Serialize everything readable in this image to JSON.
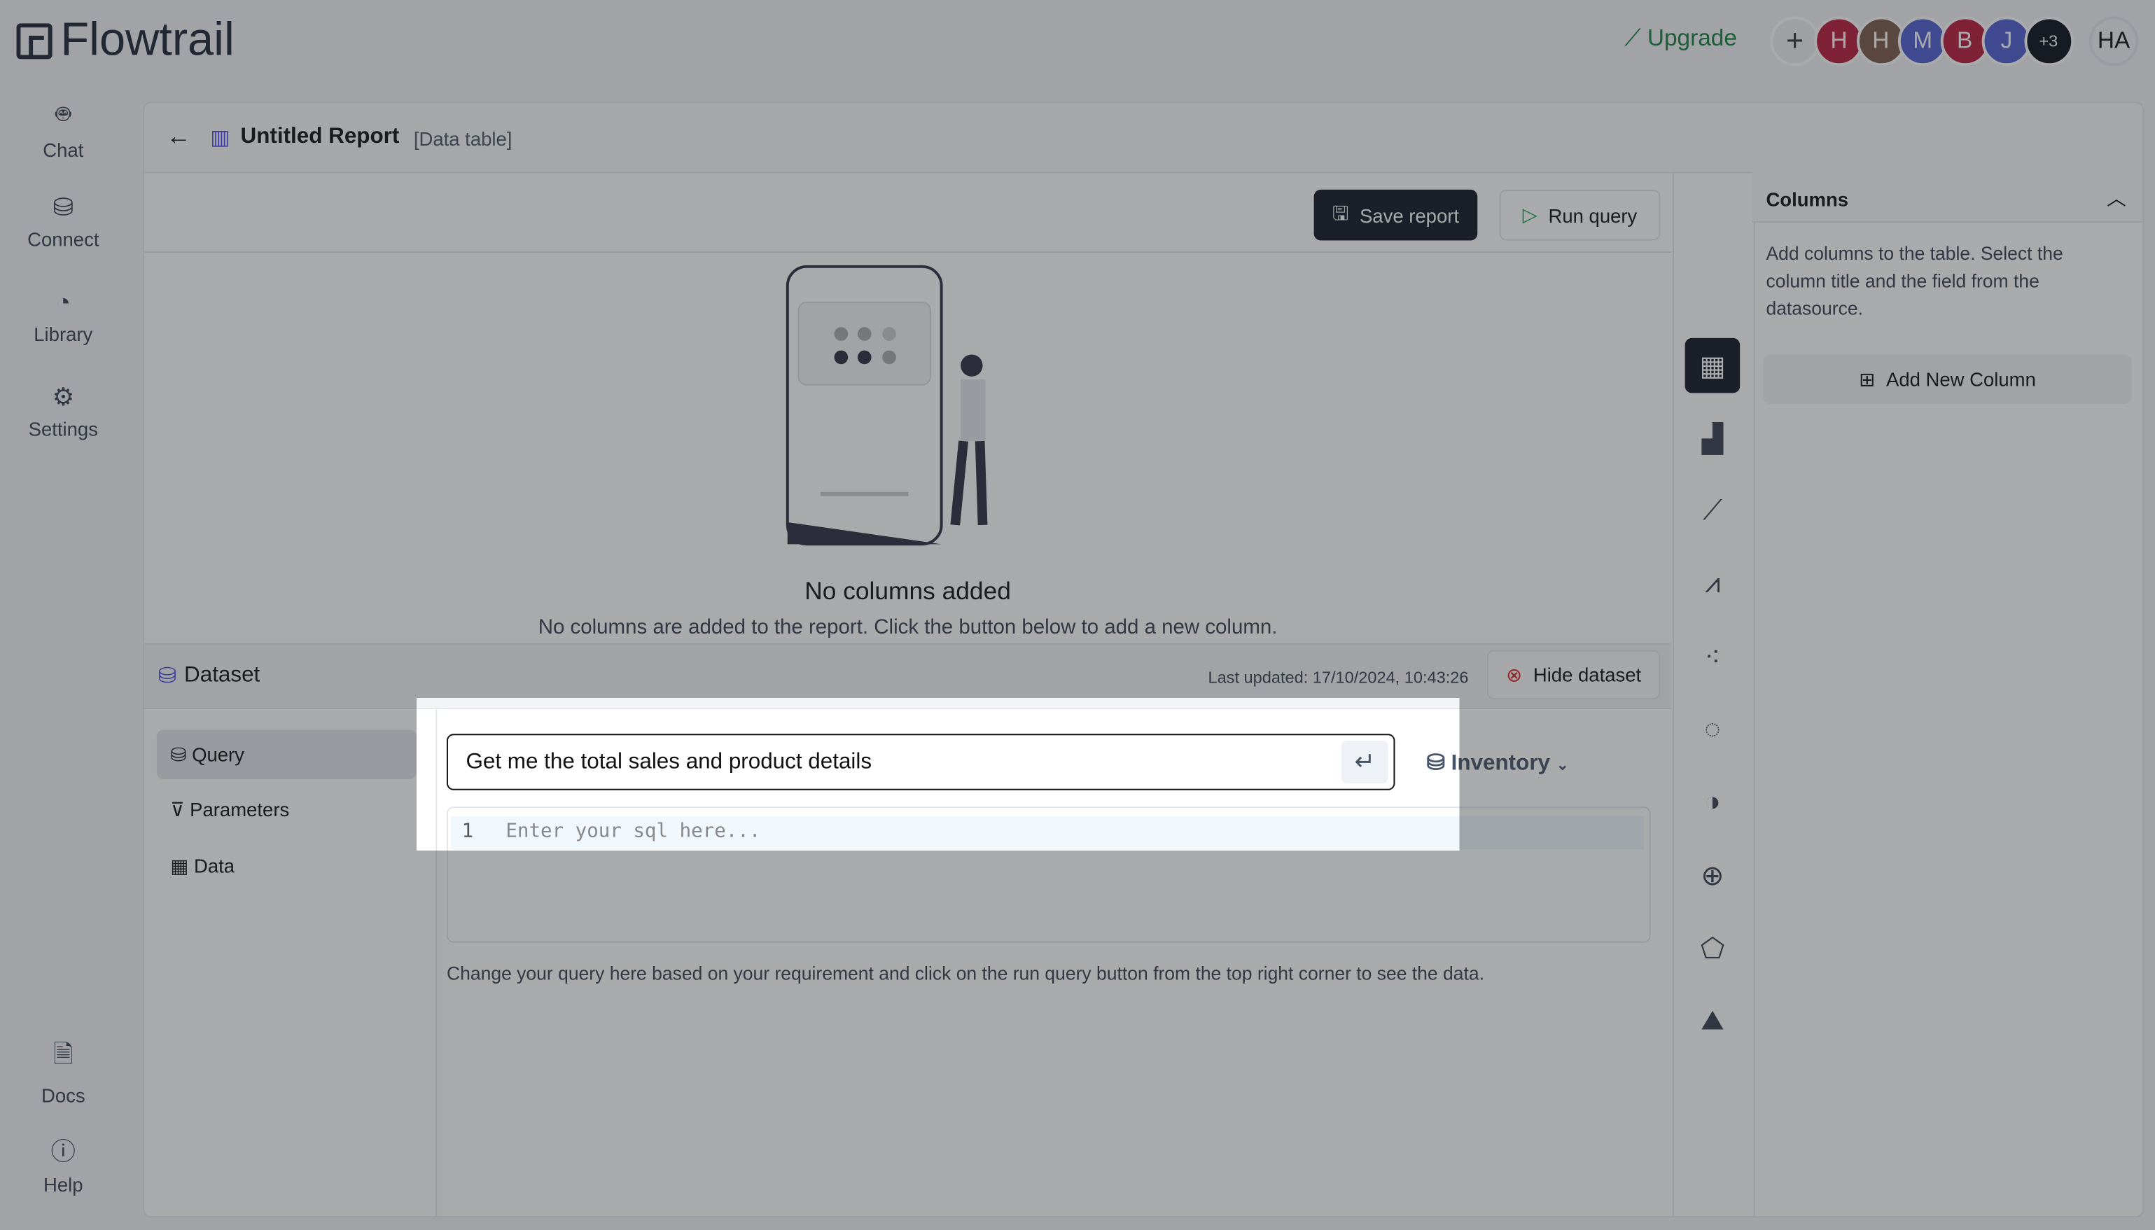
{
  "app": {
    "name": "Flowtrail"
  },
  "sidebar": {
    "items": [
      {
        "label": "Chat",
        "icon": "robot-icon"
      },
      {
        "label": "Connect",
        "icon": "database-icon"
      },
      {
        "label": "Library",
        "icon": "pie-icon"
      },
      {
        "label": "Settings",
        "icon": "gear-icon"
      }
    ],
    "bottom": [
      {
        "label": "Docs",
        "icon": "document-icon"
      },
      {
        "label": "Help",
        "icon": "help-icon"
      }
    ]
  },
  "topbar": {
    "upgrade": "Upgrade",
    "add": "+",
    "avatars": [
      {
        "initial": "H",
        "color": "#b91c3c"
      },
      {
        "initial": "H",
        "color": "#7c5a4a"
      },
      {
        "initial": "M",
        "color": "#4f5fd0"
      },
      {
        "initial": "B",
        "color": "#b91c3c"
      },
      {
        "initial": "J",
        "color": "#4f5fd0"
      },
      {
        "initial": "+3",
        "color": "#0b0f1a"
      }
    ],
    "user": "HA"
  },
  "report": {
    "title": "Untitled Report",
    "type": "[Data table]",
    "save": "Save report",
    "run": "Run query",
    "empty_title": "No columns added",
    "empty_text": "No columns are added to the report. Click the button below to add a new column."
  },
  "dataset": {
    "title": "Dataset",
    "last_updated": "Last updated: 17/10/2024, 10:43:26",
    "hide": "Hide dataset",
    "tabs": [
      "Query",
      "Parameters",
      "Data"
    ],
    "prompt": "Get me the total sales and product details",
    "datasource": "Inventory",
    "line_no": "1",
    "sql_placeholder": "Enter your sql here...",
    "hint": "Change your query here based on your requirement and click on the run query button from the top right corner to see the data."
  },
  "columns": {
    "title": "Columns",
    "desc": "Add columns to the table. Select the column title and the field from the datasource.",
    "add": "Add New Column"
  }
}
